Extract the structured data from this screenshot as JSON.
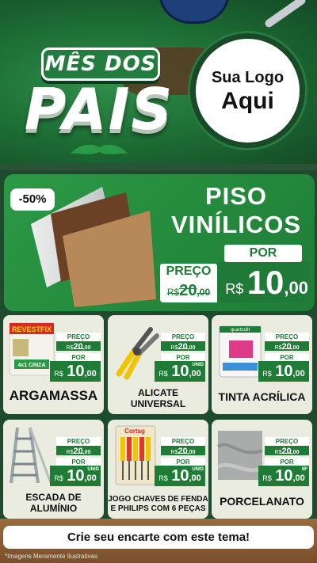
{
  "header": {
    "title_top": "MÊS DOS",
    "title_main": "PAIS",
    "logo_line1": "Sua Logo",
    "logo_line2": "Aqui"
  },
  "hero": {
    "badge": "-50%",
    "title_line1": "PISO",
    "title_line2": "VINÍLICOS",
    "por_label": "POR",
    "preco_label": "PREÇO",
    "old_currency": "R$",
    "old_int": "20",
    "old_cents": ",00",
    "new_currency": "R$",
    "new_int": "10",
    "new_cents": ",00"
  },
  "products": [
    {
      "name": "ARGAMASSA",
      "preco_label": "PREÇO",
      "por_label": "POR",
      "old_currency": "R$",
      "old_int": "20",
      "old_cents": ",00",
      "new_currency": "R$",
      "new_int": "10",
      "new_cents": ",00",
      "unit": "",
      "brand": "REVESTFIX",
      "pack_text": "4x1 CINZA"
    },
    {
      "name_line1": "ALICATE",
      "name_line2": "UNIVERSAL",
      "preco_label": "PREÇO",
      "por_label": "POR",
      "old_currency": "R$",
      "old_int": "20",
      "old_cents": ",00",
      "new_currency": "R$",
      "new_int": "10",
      "new_cents": ",00",
      "unit": "UNID"
    },
    {
      "name": "TINTA ACRÍLICA",
      "preco_label": "PREÇO",
      "por_label": "POR",
      "old_currency": "R$",
      "old_int": "20",
      "old_cents": ",00",
      "new_currency": "R$",
      "new_int": "10",
      "new_cents": ",00",
      "unit": "",
      "brand": "quartzolit"
    },
    {
      "name_line1": "ESCADA DE",
      "name_line2": "ALUMÍNIO",
      "preco_label": "PREÇO",
      "por_label": "POR",
      "old_currency": "R$",
      "old_int": "20",
      "old_cents": ",00",
      "new_currency": "R$",
      "new_int": "10",
      "new_cents": ",00",
      "unit": "UNID"
    },
    {
      "name_line1": "JOGO CHAVES DE FENDA",
      "name_line2": "E PHILIPS COM 6 PEÇAS",
      "preco_label": "PREÇO",
      "por_label": "POR",
      "old_currency": "R$",
      "old_int": "20",
      "old_cents": ",00",
      "new_currency": "R$",
      "new_int": "10",
      "new_cents": ",00",
      "unit": "UNID",
      "brand": "Cortag"
    },
    {
      "name": "PORCELANATO",
      "preco_label": "PREÇO",
      "por_label": "POR",
      "old_currency": "R$",
      "old_int": "20",
      "old_cents": ",00",
      "new_currency": "R$",
      "new_int": "10",
      "new_cents": ",00",
      "unit": "M²"
    }
  ],
  "footer": {
    "cta": "Crie seu encarte com este tema!",
    "disclaimer": "*Imagens Meramente Ilustrativas"
  },
  "colors": {
    "primary_green": "#1f7c36",
    "dark_green": "#144a25",
    "card_bg": "#e9ecdf"
  }
}
